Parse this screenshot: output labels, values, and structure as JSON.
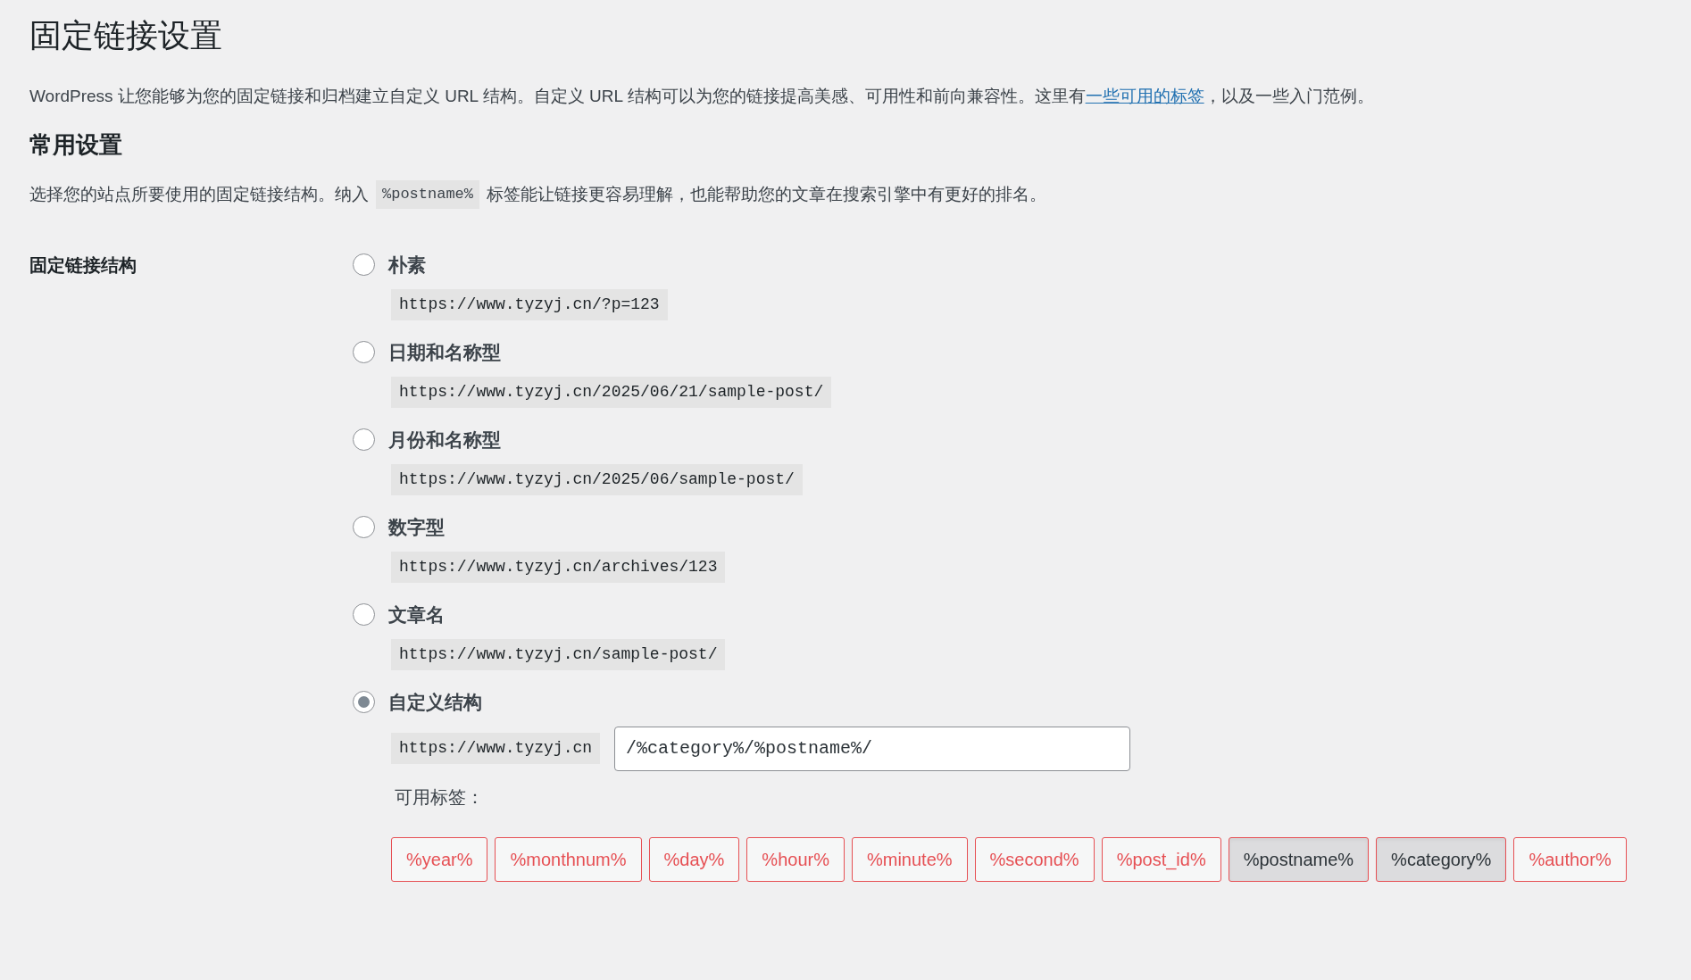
{
  "title": "固定链接设置",
  "intro": {
    "before": "WordPress 让您能够为您的固定链接和归档建立自定义 URL 结构。自定义 URL 结构可以为您的链接提高美感、可用性和前向兼容性。这里有",
    "link": "一些可用的标签",
    "after": "，以及一些入门范例。"
  },
  "section_heading": "常用设置",
  "description": {
    "before": "选择您的站点所要使用的固定链接结构。纳入",
    "code": "%postname%",
    "after": "标签能让链接更容易理解，也能帮助您的文章在搜索引擎中有更好的排名。"
  },
  "field_label": "固定链接结构",
  "options": [
    {
      "label": "朴素",
      "kind": "example",
      "example": "https://www.tyzyj.cn/?p=123",
      "selected": false
    },
    {
      "label": "日期和名称型",
      "kind": "example",
      "example": "https://www.tyzyj.cn/2025/06/21/sample-post/",
      "selected": false
    },
    {
      "label": "月份和名称型",
      "kind": "example",
      "example": "https://www.tyzyj.cn/2025/06/sample-post/",
      "selected": false
    },
    {
      "label": "数字型",
      "kind": "example",
      "example": "https://www.tyzyj.cn/archives/123",
      "selected": false
    },
    {
      "label": "文章名",
      "kind": "example",
      "example": "https://www.tyzyj.cn/sample-post/",
      "selected": false
    },
    {
      "label": "自定义结构",
      "kind": "custom",
      "prefix": "https://www.tyzyj.cn",
      "value": "/%category%/%postname%/",
      "selected": true
    }
  ],
  "tags_label": "可用标签：",
  "tags": [
    {
      "label": "%year%",
      "selected": false
    },
    {
      "label": "%monthnum%",
      "selected": false
    },
    {
      "label": "%day%",
      "selected": false
    },
    {
      "label": "%hour%",
      "selected": false
    },
    {
      "label": "%minute%",
      "selected": false
    },
    {
      "label": "%second%",
      "selected": false
    },
    {
      "label": "%post_id%",
      "selected": false
    },
    {
      "label": "%postname%",
      "selected": true
    },
    {
      "label": "%category%",
      "selected": true
    },
    {
      "label": "%author%",
      "selected": false
    }
  ]
}
